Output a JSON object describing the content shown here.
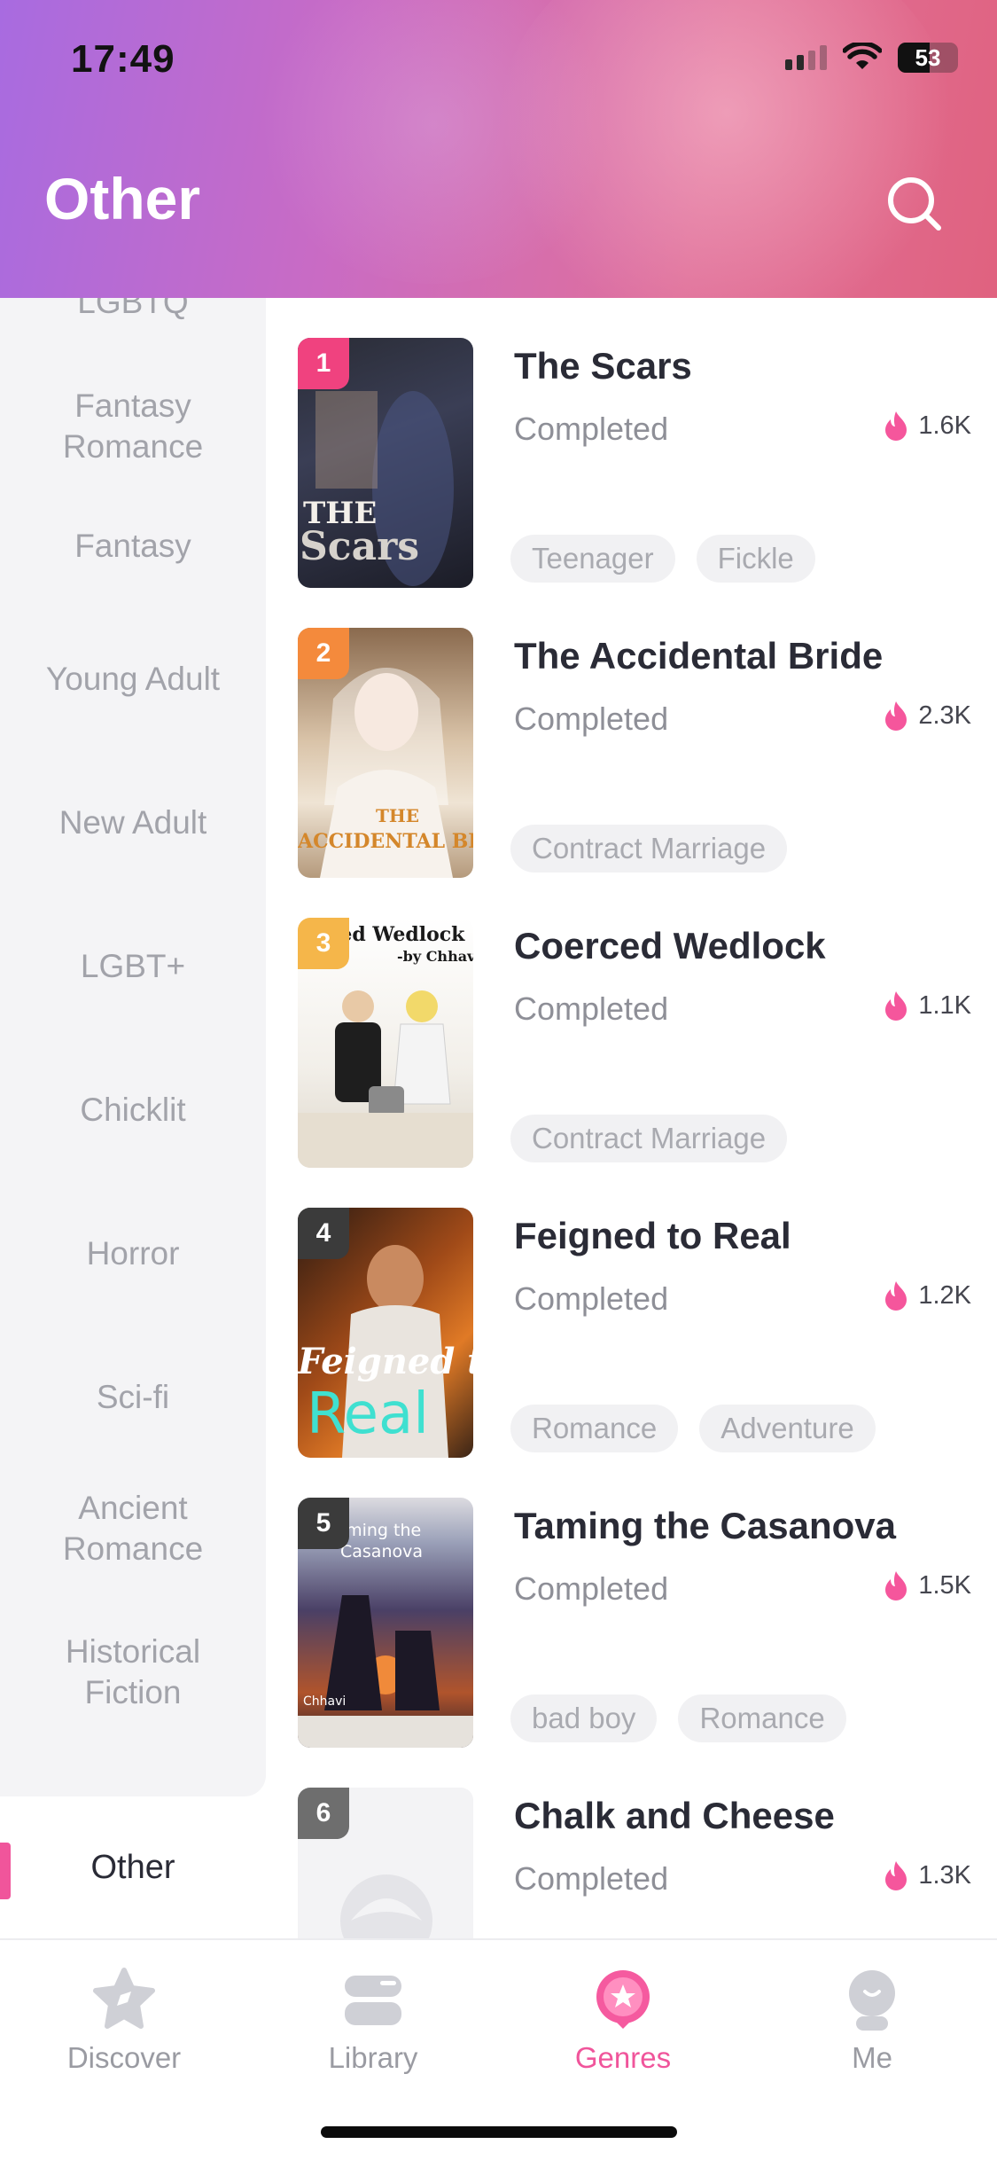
{
  "status_bar": {
    "time": "17:49",
    "battery": "53",
    "battery_level": 0.53
  },
  "header": {
    "title": "Other"
  },
  "sidebar": {
    "items": [
      {
        "label": "LGBTQ"
      },
      {
        "label": "Fantasy Romance"
      },
      {
        "label": "Fantasy"
      },
      {
        "label": "Young Adult"
      },
      {
        "label": "New Adult"
      },
      {
        "label": "LGBT+"
      },
      {
        "label": "Chicklit"
      },
      {
        "label": "Horror"
      },
      {
        "label": "Sci-fi"
      },
      {
        "label": "Ancient Romance"
      },
      {
        "label": "Historical Fiction"
      }
    ],
    "active": {
      "label": "Other"
    }
  },
  "books": [
    {
      "rank": "1",
      "title": "The Scars",
      "status": "Completed",
      "popularity": "1.6K",
      "tags": [
        "Teenager",
        "Fickle"
      ],
      "rank_color": "#f0427f",
      "cover_lines": [
        "THE",
        "Scars"
      ]
    },
    {
      "rank": "2",
      "title": "The Accidental Bride",
      "status": "Completed",
      "popularity": "2.3K",
      "tags": [
        "Contract Marriage"
      ],
      "rank_color": "#f48a3c",
      "cover_lines": [
        "THE",
        "ACCIDENTAL BRIDE"
      ]
    },
    {
      "rank": "3",
      "title": "Coerced Wedlock",
      "status": "Completed",
      "popularity": "1.1K",
      "tags": [
        "Contract Marriage"
      ],
      "rank_color": "#f5b64a",
      "cover_lines": [
        "ced Wedlock",
        "-by Chhavi"
      ]
    },
    {
      "rank": "4",
      "title": "Feigned to Real",
      "status": "Completed",
      "popularity": "1.2K",
      "tags": [
        "Romance",
        "Adventure"
      ],
      "rank_color": "#3b3b3b",
      "cover_lines": [
        "Feigned to",
        "Real"
      ]
    },
    {
      "rank": "5",
      "title": "Taming the Casanova",
      "status": "Completed",
      "popularity": "1.5K",
      "tags": [
        "bad boy",
        "Romance"
      ],
      "rank_color": "#3b3b3b",
      "cover_lines": [
        "Taming the",
        "Casanova",
        "Chhavi"
      ]
    },
    {
      "rank": "6",
      "title": "Chalk and Cheese",
      "status": "Completed",
      "popularity": "1.3K",
      "tags": [],
      "rank_color": "#6e6e6e",
      "cover_lines": []
    }
  ],
  "bottom_nav": [
    {
      "label": "Discover",
      "icon": "discover-icon"
    },
    {
      "label": "Library",
      "icon": "library-icon"
    },
    {
      "label": "Genres",
      "icon": "genres-icon",
      "active": true
    },
    {
      "label": "Me",
      "icon": "me-icon"
    }
  ],
  "colors": {
    "accent": "#f0559b",
    "popularity_flame": "#f5569c"
  }
}
